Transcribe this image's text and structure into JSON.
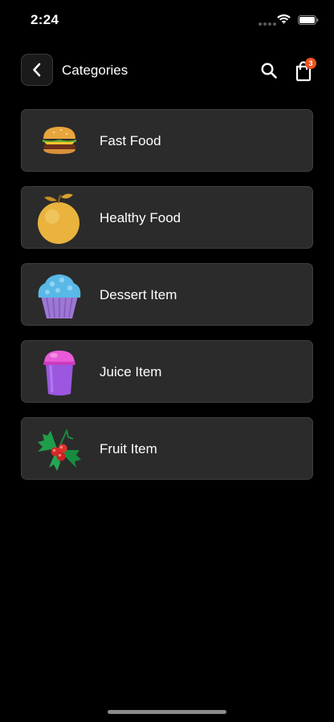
{
  "status_bar": {
    "time": "2:24"
  },
  "header": {
    "title": "Categories",
    "cart_count": "3"
  },
  "categories": [
    {
      "label": "Fast Food",
      "icon": "burger-icon"
    },
    {
      "label": "Healthy Food",
      "icon": "orange-icon"
    },
    {
      "label": "Dessert Item",
      "icon": "cupcake-icon"
    },
    {
      "label": "Juice Item",
      "icon": "juice-cup-icon"
    },
    {
      "label": "Fruit Item",
      "icon": "holly-berries-icon"
    }
  ],
  "colors": {
    "background": "#000000",
    "card": "#2b2b2b",
    "card_border": "#3e3e3e",
    "badge": "#f0521f"
  }
}
